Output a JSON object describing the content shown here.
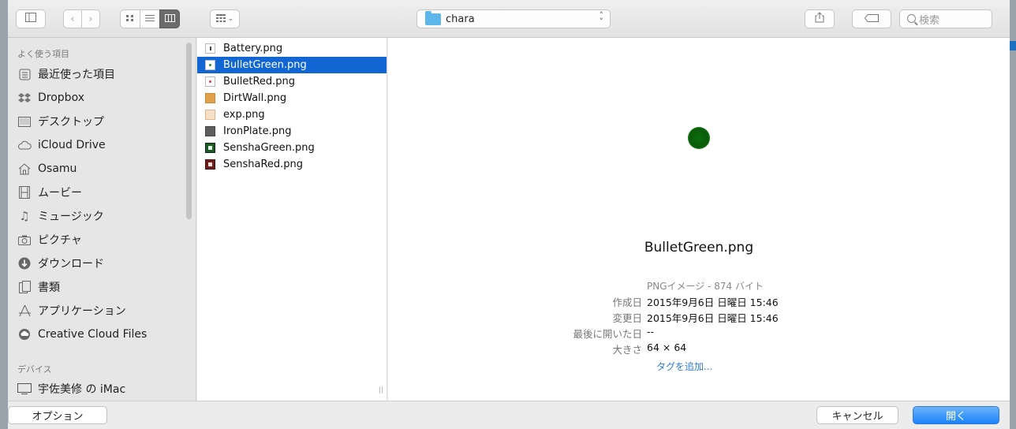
{
  "toolbar": {
    "current_folder": "chara",
    "search_placeholder": "検索",
    "view_arrange_icon": "grid-icon"
  },
  "sidebar": {
    "favorites_heading": "よく使う項目",
    "favorites": [
      {
        "label": "最近使った項目",
        "icon": "recents-icon"
      },
      {
        "label": "Dropbox",
        "icon": "dropbox-icon"
      },
      {
        "label": "デスクトップ",
        "icon": "desktop-icon"
      },
      {
        "label": "iCloud Drive",
        "icon": "cloud-icon"
      },
      {
        "label": "Osamu",
        "icon": "home-icon"
      },
      {
        "label": "ムービー",
        "icon": "film-icon"
      },
      {
        "label": "ミュージック",
        "icon": "music-icon"
      },
      {
        "label": "ピクチャ",
        "icon": "camera-icon"
      },
      {
        "label": "ダウンロード",
        "icon": "download-icon"
      },
      {
        "label": "書類",
        "icon": "documents-icon"
      },
      {
        "label": "アプリケーション",
        "icon": "applications-icon"
      },
      {
        "label": "Creative Cloud Files",
        "icon": "creative-cloud-icon"
      }
    ],
    "devices_heading": "デバイス",
    "devices": [
      {
        "label": "宇佐美修 の iMac",
        "icon": "imac-icon"
      }
    ]
  },
  "files": [
    {
      "name": "Battery.png"
    },
    {
      "name": "BulletGreen.png",
      "selected": true
    },
    {
      "name": "BulletRed.png"
    },
    {
      "name": "DirtWall.png"
    },
    {
      "name": "exp.png"
    },
    {
      "name": "IronPlate.png"
    },
    {
      "name": "SenshaGreen.png"
    },
    {
      "name": "SenshaRed.png"
    }
  ],
  "preview": {
    "filename": "BulletGreen.png",
    "kind": "PNGイメージ - 874 バイト",
    "info": [
      {
        "label": "作成日",
        "value": "2015年9月6日 日曜日 15:46"
      },
      {
        "label": "変更日",
        "value": "2015年9月6日 日曜日 15:46"
      },
      {
        "label": "最後に開いた日",
        "value": "--"
      },
      {
        "label": "大きさ",
        "value": "64 × 64"
      }
    ],
    "add_tag": "タグを追加..."
  },
  "buttons": {
    "options": "オプション",
    "cancel": "キャンセル",
    "open": "開く"
  },
  "colors": {
    "selection": "#1266d4",
    "primary_button": "#1a82fb",
    "preview_dot": "#0b6d0b"
  }
}
